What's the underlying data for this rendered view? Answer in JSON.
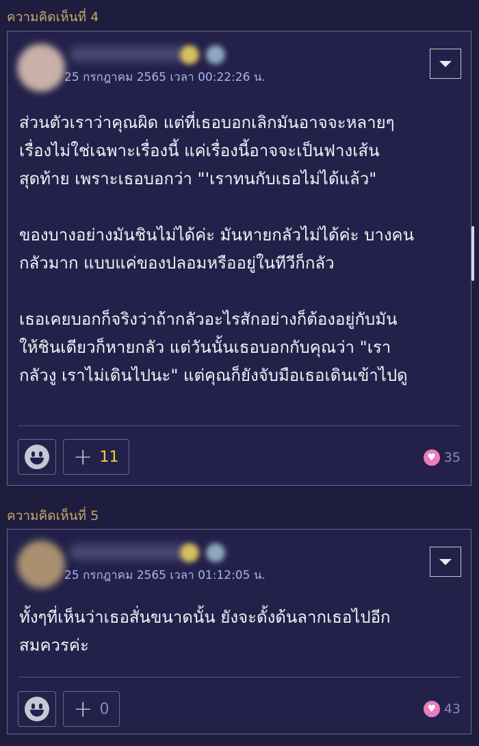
{
  "comments": [
    {
      "label": "ความคิดเห็นที่ 4",
      "timestamp": "25 กรกฎาคม 2565 เวลา 00:22:26 น.",
      "body": "ส่วนตัวเราว่าคุณผิด แต่ที่เธอบอกเลิกมันอาจจะหลายๆ\nเรื่องไม่ใช่เฉพาะเรื่องนี้ แค่เรื่องนี้อาจจะเป็นฟางเส้น\nสุดท้าย เพราะเธอบอกว่า \"'เราทนกับเธอไม่ได้แล้ว\"\n\nของบางอย่างมันชินไม่ได้ค่ะ มันหายกลัวไม่ได้ค่ะ บางคน\nกลัวมาก แบบแค่ของปลอมหรืออยู่ในทีวีก็กลัว\n\nเธอเคยบอกก็จริงว่าถ้ากลัวอะไรสักอย่างก็ต้องอยู่กับมัน\nให้ชินเดียวก็หายกลัว แต่วันนั้นเธอบอกกับคุณว่า \"เรา\nกลัวงู เราไม่เดินไปนะ\" แต่คุณก็ยังจับมือเธอเดินเข้าไปดู",
      "vote_plus": "+",
      "vote_count": "11",
      "vote_color": "#f2d22e",
      "likes": "35"
    },
    {
      "label": "ความคิดเห็นที่ 5",
      "timestamp": "25 กรกฎาคม 2565 เวลา 01:12:05 น.",
      "body": "ทั้งๆที่เห็นว่าเธอสั่นขนาดนั้น ยังจะดั้งด้นลากเธอไปอีก\nสมควรค่ะ",
      "vote_plus": "+",
      "vote_count": "0",
      "vote_color": "#8d8bb0",
      "likes": "43"
    }
  ]
}
